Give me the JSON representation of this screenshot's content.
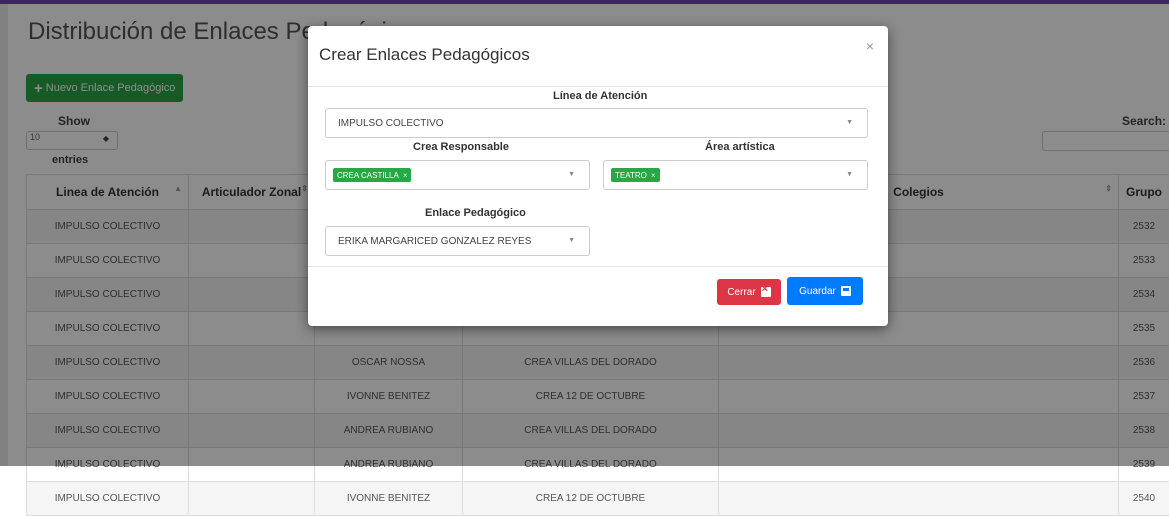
{
  "page": {
    "title": "Distribución de Enlaces Pedagógicos",
    "new_button_label": "Nuevo Enlace Pedagógico",
    "show_label": "Show",
    "length_value": "10",
    "entries_label": "entries",
    "search_label": "Search:"
  },
  "table": {
    "columns": [
      "Linea de Atención",
      "Articulador Zonal",
      "",
      "",
      "Colegios",
      "Grupo"
    ],
    "rows": [
      [
        "IMPULSO COLECTIVO",
        "",
        "",
        "",
        "",
        "2532"
      ],
      [
        "IMPULSO COLECTIVO",
        "",
        "",
        "",
        "",
        "2533"
      ],
      [
        "IMPULSO COLECTIVO",
        "",
        "",
        "",
        "",
        "2534"
      ],
      [
        "IMPULSO COLECTIVO",
        "",
        "",
        "",
        "",
        "2535"
      ],
      [
        "IMPULSO COLECTIVO",
        "",
        "OSCAR NOSSA",
        "CREA VILLAS DEL DORADO",
        "",
        "2536"
      ],
      [
        "IMPULSO COLECTIVO",
        "",
        "IVONNE BENITEZ",
        "CREA 12 DE OCTUBRE",
        "",
        "2537"
      ],
      [
        "IMPULSO COLECTIVO",
        "",
        "ANDREA RUBIANO",
        "CREA VILLAS DEL DORADO",
        "",
        "2538"
      ],
      [
        "IMPULSO COLECTIVO",
        "",
        "ANDREA RUBIANO",
        "CREA VILLAS DEL DORADO",
        "",
        "2539"
      ],
      [
        "IMPULSO COLECTIVO",
        "",
        "IVONNE BENITEZ",
        "CREA 12 DE OCTUBRE",
        "",
        "2540"
      ]
    ]
  },
  "modal": {
    "title": "Crear Enlaces Pedagógicos",
    "close_symbol": "×",
    "linea_label": "Línea de Atención",
    "linea_value": "IMPULSO COLECTIVO",
    "crea_label": "Crea Responsable",
    "crea_tag": "CREA CASTILLA",
    "area_label": "Área artística",
    "area_tag": "TEATRO",
    "tag_remove": "×",
    "enlace_label": "Enlace Pedagógico",
    "enlace_value": "ERIKA MARGARICED GONZALEZ REYES",
    "cerrar_label": "Cerrar",
    "guardar_label": "Guardar"
  },
  "colors": {
    "accent": "#6f42c1",
    "success": "#28a745",
    "danger": "#dc3545",
    "primary": "#007bff"
  }
}
